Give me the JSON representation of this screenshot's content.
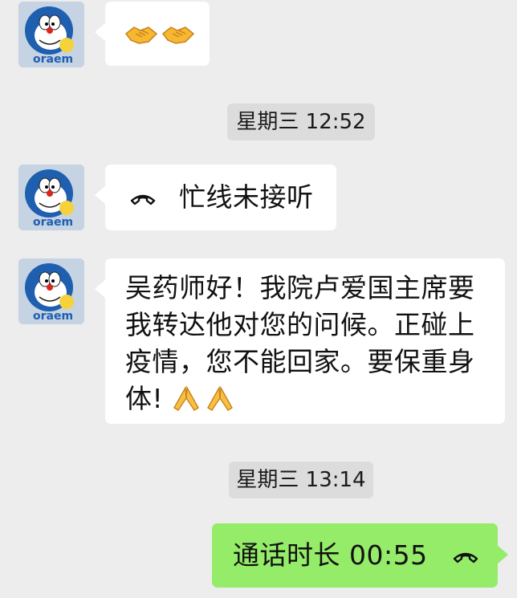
{
  "messages": {
    "m1": {
      "sender": "contact",
      "emojis": [
        "handshake-emoji",
        "handshake-emoji"
      ]
    },
    "ts1": "星期三 12:52",
    "m2": {
      "sender": "contact",
      "icon": "phone-hangup-icon",
      "text": "忙线未接听"
    },
    "m3": {
      "sender": "contact",
      "line1": "吴药师好！我院卢爱国主席要",
      "line2": "我转达他对您的问候。正碰上",
      "line3": "疫情，您不能回家。要保重身",
      "line4": "体!",
      "emojis": [
        "folded-hands-emoji",
        "folded-hands-emoji"
      ]
    },
    "ts2": "星期三 13:14",
    "m4": {
      "sender": "me",
      "text": "通话时长 00:55",
      "icon": "phone-hangup-icon"
    }
  },
  "colors": {
    "background": "#ededed",
    "incoming_bubble": "#ffffff",
    "outgoing_bubble": "#95ec69",
    "timestamp_chip": "#dcdcdc"
  }
}
